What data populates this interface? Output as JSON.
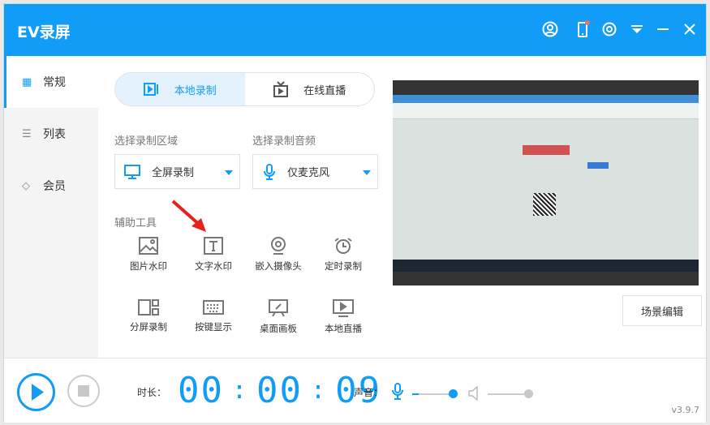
{
  "app": {
    "title": "EV录屏",
    "version": "v3.9.7",
    "accent": "#119cf7"
  },
  "titlebar_icons": [
    "user-icon",
    "phone-icon",
    "gear-icon",
    "dropdown-icon",
    "minimize-icon",
    "close-icon"
  ],
  "sidebar": {
    "items": [
      {
        "label": "常规",
        "icon": "grid-icon"
      },
      {
        "label": "列表",
        "icon": "list-icon"
      },
      {
        "label": "会员",
        "icon": "diamond-icon"
      }
    ]
  },
  "tabs": [
    {
      "label": "本地录制"
    },
    {
      "label": "在线直播"
    }
  ],
  "area": {
    "label": "选择录制区域",
    "value": "全屏录制"
  },
  "audio": {
    "label": "选择录制音频",
    "value": "仅麦克风"
  },
  "tools": {
    "label": "辅助工具",
    "items": [
      "图片水印",
      "文字水印",
      "嵌入摄像头",
      "定时录制",
      "分屏录制",
      "按键显示",
      "桌面画板",
      "本地直播"
    ]
  },
  "scene_button": "场景编辑",
  "bottom": {
    "duration_label": "时长：",
    "hh": "00",
    "mm": "00",
    "ss": "09",
    "volume_label": "声音：",
    "mic_level": 1.0,
    "speaker_level": 1.0
  }
}
